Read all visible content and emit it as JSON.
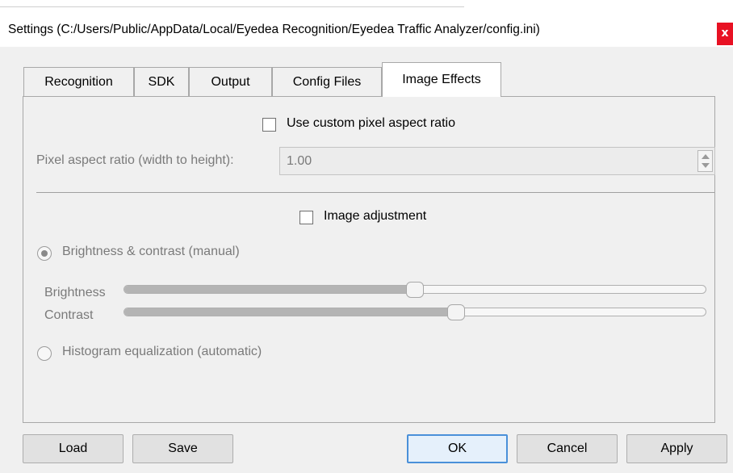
{
  "window": {
    "title": "Settings (C:/Users/Public/AppData/Local/Eyedea Recognition/Eyedea Traffic Analyzer/config.ini)",
    "close_glyph": "x"
  },
  "tabs": [
    {
      "label": "Recognition",
      "active": false
    },
    {
      "label": "SDK",
      "active": false
    },
    {
      "label": "Output",
      "active": false
    },
    {
      "label": "Config Files",
      "active": false
    },
    {
      "label": "Image Effects",
      "active": true
    }
  ],
  "image_effects": {
    "custom_ratio_checkbox": {
      "label": "Use custom pixel aspect ratio",
      "checked": false
    },
    "pixel_ratio": {
      "label": "Pixel aspect ratio (width to height):",
      "value": "1.00"
    },
    "image_adjustment_checkbox": {
      "label": "Image adjustment",
      "checked": false
    },
    "manual_radio": {
      "label": "Brightness & contrast (manual)",
      "selected": true
    },
    "brightness": {
      "label": "Brightness",
      "level": 0.5
    },
    "contrast": {
      "label": "Contrast",
      "level": 0.57
    },
    "auto_radio": {
      "label": "Histogram equalization (automatic)",
      "selected": false
    }
  },
  "buttons": {
    "load": "Load",
    "save": "Save",
    "ok": "OK",
    "cancel": "Cancel",
    "apply": "Apply"
  },
  "colors": {
    "close_button": "#e81123",
    "default_button_border": "#4a90d9"
  }
}
